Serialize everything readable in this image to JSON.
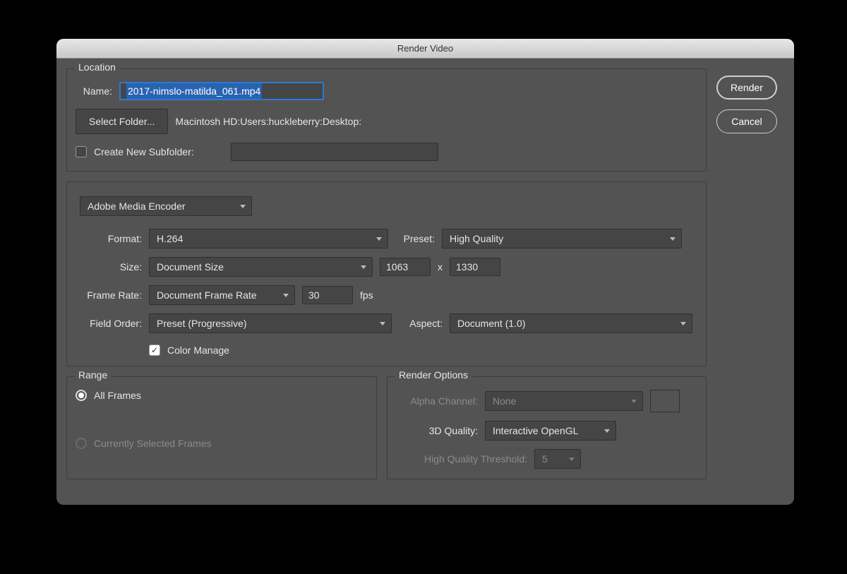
{
  "title": "Render Video",
  "buttons": {
    "render": "Render",
    "cancel": "Cancel"
  },
  "location": {
    "legend": "Location",
    "name_label": "Name:",
    "name_value": "2017-nimslo-matilda_061.mp4",
    "select_folder": "Select Folder...",
    "folder_path": "Macintosh HD:Users:huckleberry:Desktop:",
    "subfolder_label": "Create New Subfolder:",
    "subfolder_checked": false,
    "subfolder_value": ""
  },
  "encoder": {
    "type": "Adobe Media Encoder",
    "format_label": "Format:",
    "format": "H.264",
    "preset_label": "Preset:",
    "preset": "High Quality",
    "size_label": "Size:",
    "size_mode": "Document Size",
    "width": "1063",
    "height": "1330",
    "x": "x",
    "fr_label": "Frame Rate:",
    "fr_mode": "Document Frame Rate",
    "fr_value": "30",
    "fps": "fps",
    "fo_label": "Field Order:",
    "fo": "Preset (Progressive)",
    "aspect_label": "Aspect:",
    "aspect": "Document (1.0)",
    "cm_label": "Color Manage",
    "cm_checked": true
  },
  "range": {
    "legend": "Range",
    "all": "All Frames",
    "sel": "Currently Selected Frames"
  },
  "render_options": {
    "legend": "Render Options",
    "alpha_label": "Alpha Channel:",
    "alpha": "None",
    "quality_label": "3D Quality:",
    "quality": "Interactive OpenGL",
    "hq_label": "High Quality Threshold:",
    "hq": "5"
  }
}
